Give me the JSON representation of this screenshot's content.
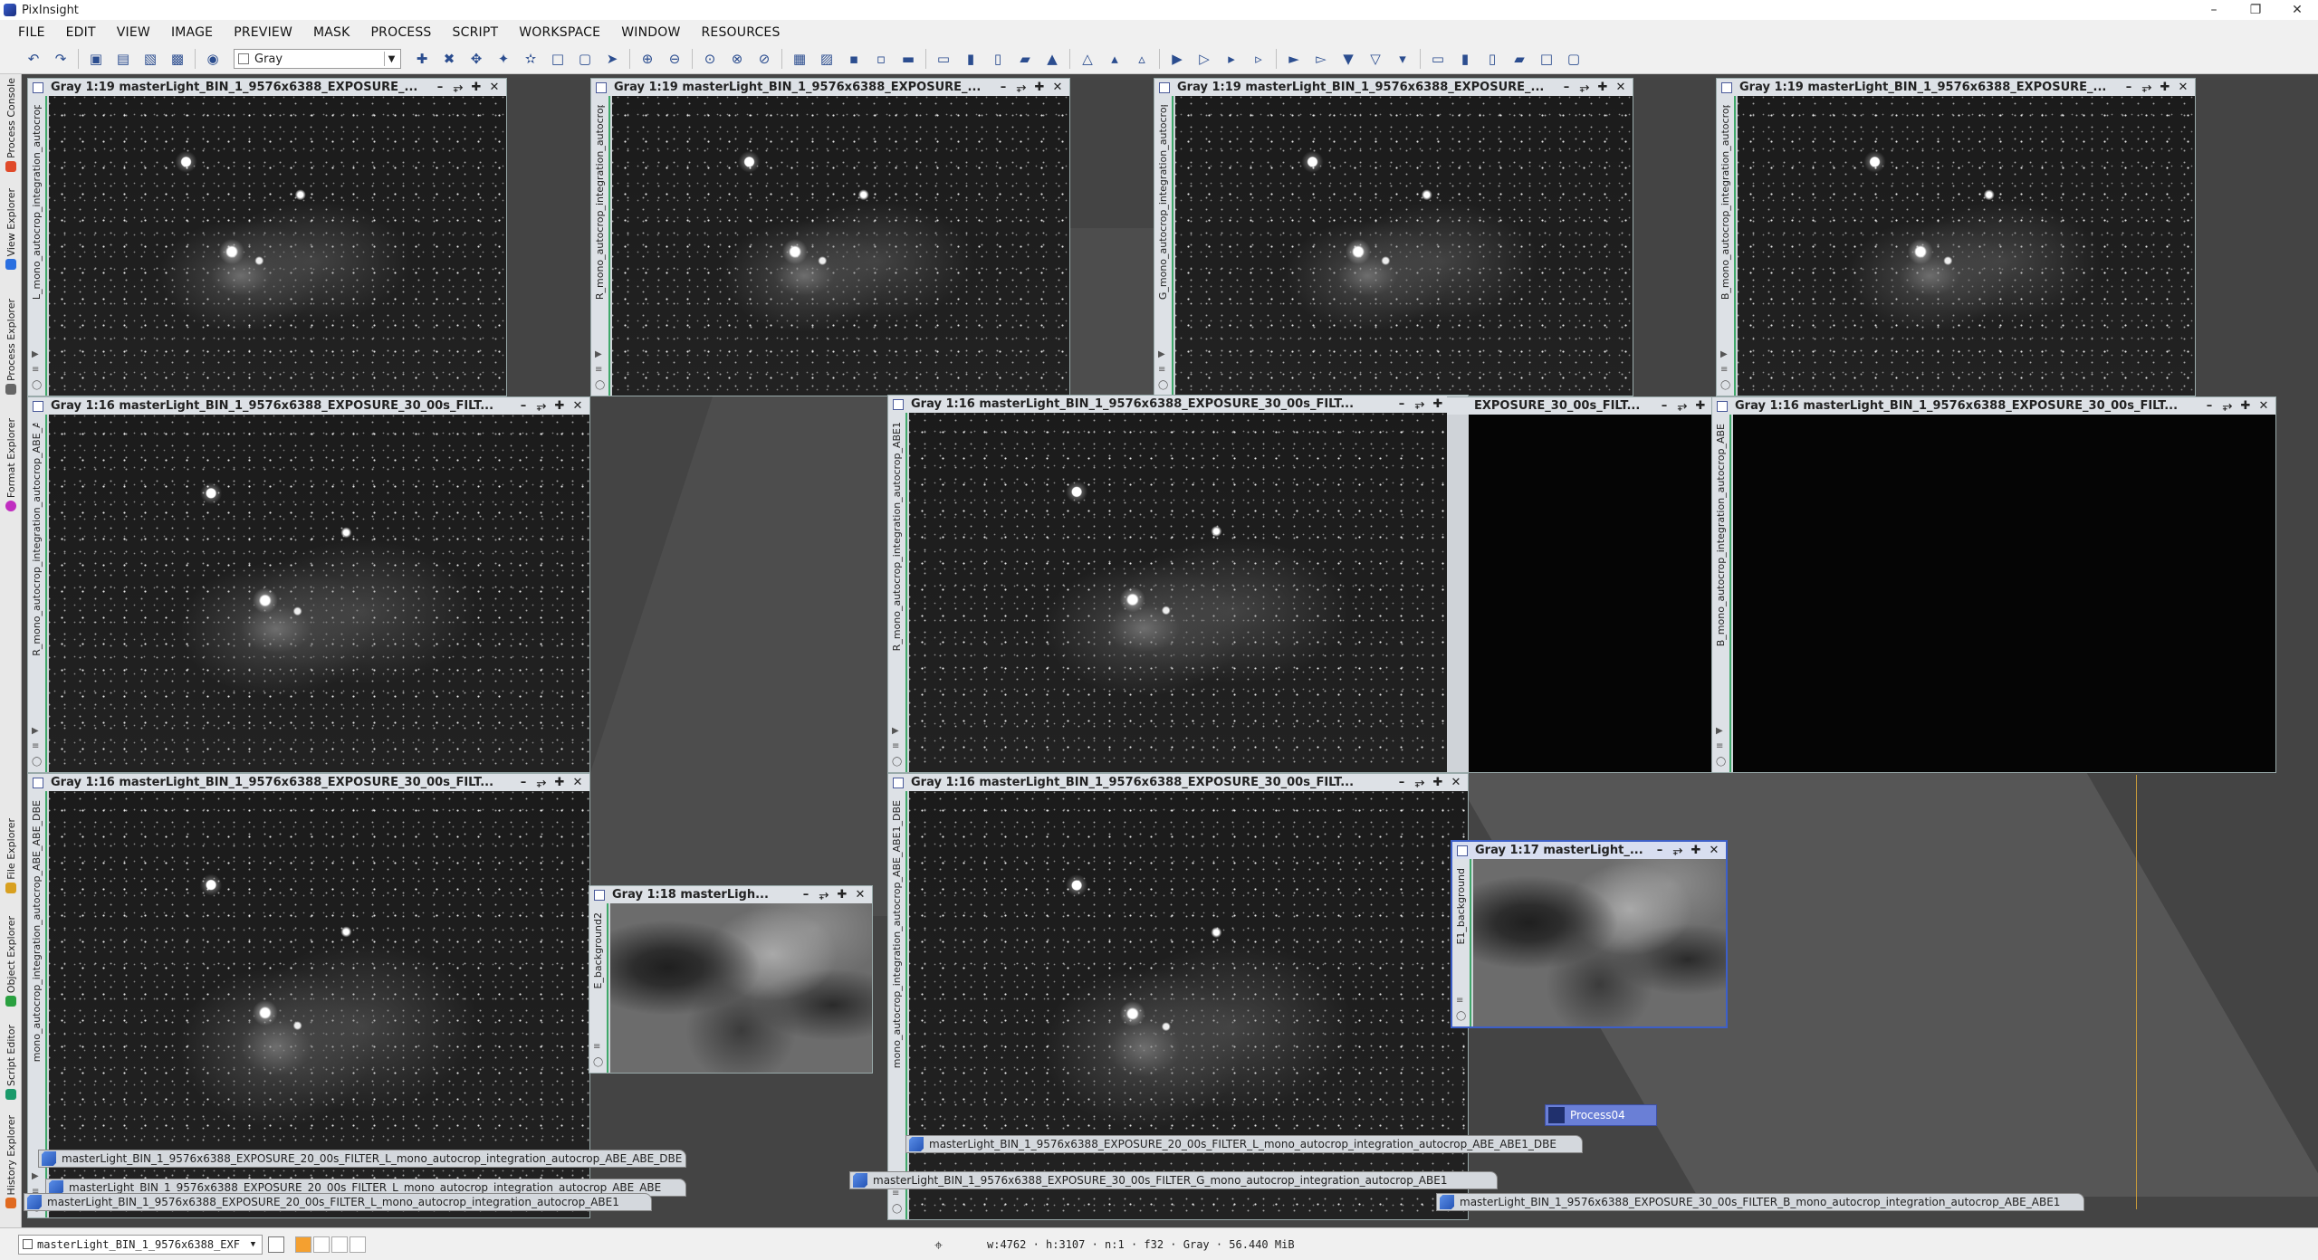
{
  "app": {
    "title": "PixInsight"
  },
  "menu": [
    "FILE",
    "EDIT",
    "VIEW",
    "IMAGE",
    "PREVIEW",
    "MASK",
    "PROCESS",
    "SCRIPT",
    "WORKSPACE",
    "WINDOW",
    "RESOURCES"
  ],
  "toolbar": {
    "colorspace_value": "Gray"
  },
  "left_dock": [
    "Process Console",
    "View Explorer",
    "Process Explorer",
    "Format Explorer",
    "File Explorer",
    "Object Explorer",
    "Script Editor",
    "History Explorer"
  ],
  "windows": [
    {
      "title": "Gray 1:19 masterLight_BIN_1_9576x6388_EXPOSURE_...",
      "side": "L_mono_autocrop_integration_autocrop"
    },
    {
      "title": "Gray 1:19 masterLight_BIN_1_9576x6388_EXPOSURE_...",
      "side": "R_mono_autocrop_integration_autocrop"
    },
    {
      "title": "Gray 1:19 masterLight_BIN_1_9576x6388_EXPOSURE_...",
      "side": "G_mono_autocrop_integration_autocrop"
    },
    {
      "title": "Gray 1:19 masterLight_BIN_1_9576x6388_EXPOSURE_...",
      "side": "B_mono_autocrop_integration_autocrop"
    },
    {
      "title": "Gray 1:16 masterLight_BIN_1_9576x6388_EXPOSURE_30_00s_FILT...",
      "side": "R_mono_autocrop_integration_autocrop_ABE_ABE"
    },
    {
      "title": "Gray 1:16 masterLight_BIN_1_9576x6388_EXPOSURE_30_00s_FILT...",
      "side": "R_mono_autocrop_integration_autocrop_ABE1"
    },
    {
      "title": "EXPOSURE_30_00s_FILT...",
      "side": ""
    },
    {
      "title": "Gray 1:16 masterLight_BIN_1_9576x6388_EXPOSURE_30_00s_FILT...",
      "side": "B_mono_autocrop_integration_autocrop_ABE"
    },
    {
      "title": "Gray 1:16 masterLight_BIN_1_9576x6388_EXPOSURE_30_00s_FILT...",
      "side": "mono_autocrop_integration_autocrop_ABE_ABE_DBE"
    },
    {
      "title": "Gray 1:16 masterLight_BIN_1_9576x6388_EXPOSURE_30_00s_FILT...",
      "side": "mono_autocrop_integration_autocrop_ABE_ABE1_DBE"
    },
    {
      "title": "Gray 1:18 masterLigh...",
      "side": "E_background2"
    },
    {
      "title": "Gray 1:17 masterLight_...",
      "side": "E1_background"
    }
  ],
  "icons": [
    "masterLight_BIN_1_9576x6388_EXPOSURE_20_00s_FILTER_L_mono_autocrop_integration_autocrop_ABE_ABE_DBE",
    "masterLight_BIN_1_9576x6388_EXPOSURE_20_00s_FILTER_L_mono_autocrop_integration_autocrop_ABE_ABE",
    "masterLight_BIN_1_9576x6388_EXPOSURE_20_00s_FILTER_L_mono_autocrop_integration_autocrop_ABE1",
    "masterLight_BIN_1_9576x6388_EXPOSURE_20_00s_FILTER_L_mono_autocrop_integration_autocrop_ABE_ABE1_DBE",
    "masterLight_BIN_1_9576x6388_EXPOSURE_30_00s_FILTER_G_mono_autocrop_integration_autocrop_ABE1",
    "masterLight_BIN_1_9576x6388_EXPOSURE_30_00s_FILTER_B_mono_autocrop_integration_autocrop_ABE_ABE1"
  ],
  "process_icon": "Process04",
  "statusbar": {
    "view_select": "masterLight_BIN_1_9576x6388_EXF",
    "info": "w:4762 · h:3107 · n:1 · f32 · Gray · 56.440 MiB"
  }
}
